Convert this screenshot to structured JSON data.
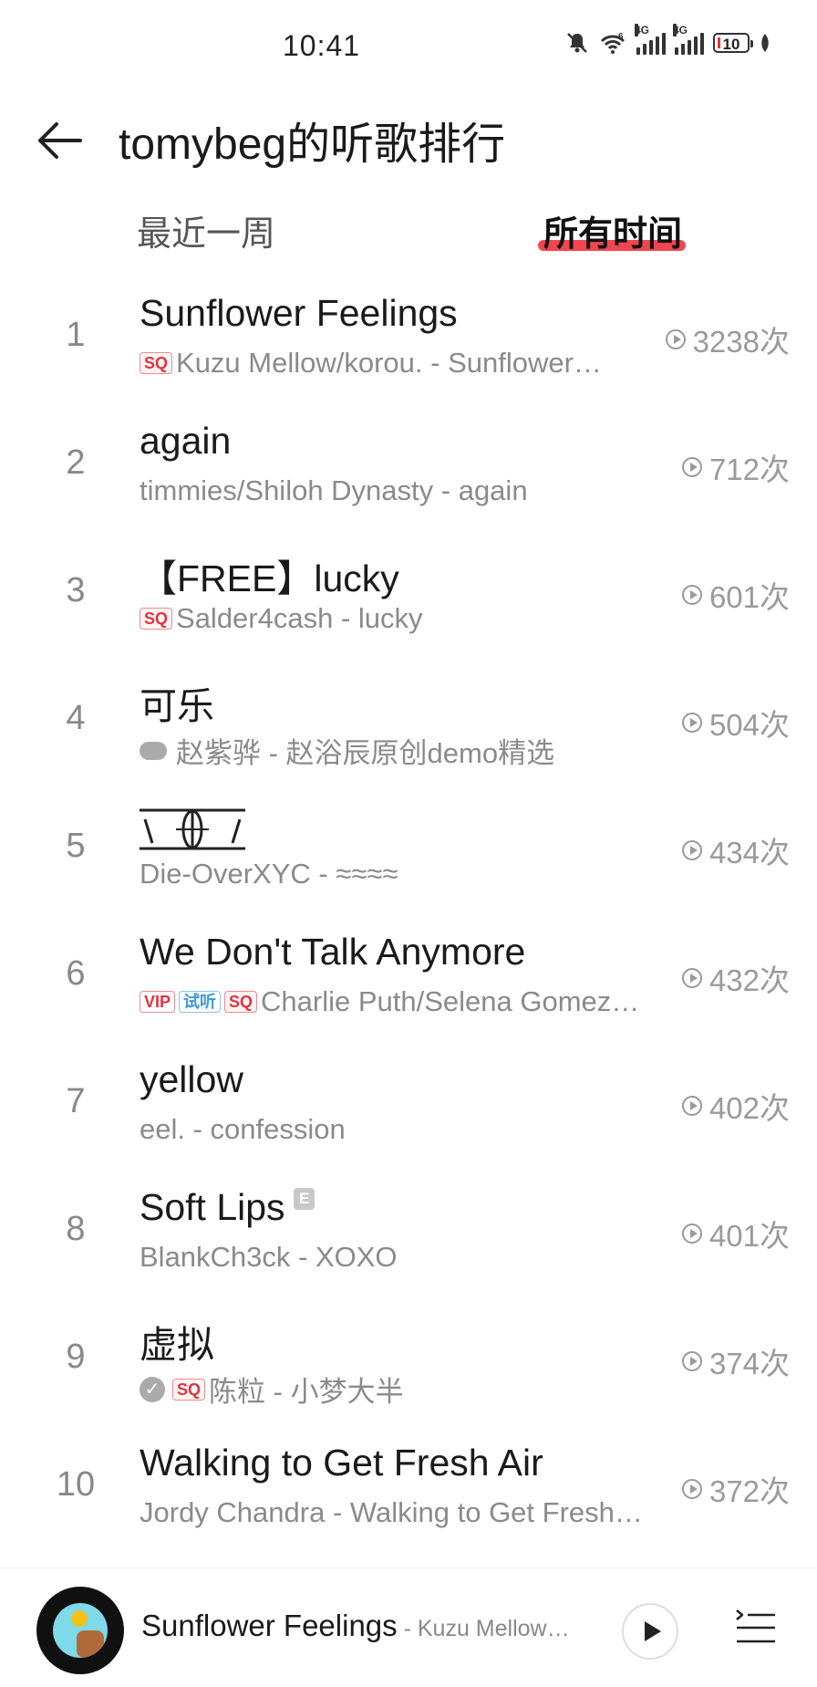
{
  "status": {
    "time": "10:41",
    "battery": "10",
    "net1": "4G",
    "net2": "4G",
    "wifi_label": "6"
  },
  "header": {
    "title": "tomybeg的听歌排行"
  },
  "tabs": [
    {
      "label": "最近一周"
    },
    {
      "label": "所有时间"
    }
  ],
  "list": [
    {
      "rank": "1",
      "title": "Sunflower Feelings",
      "subtitle": "Kuzu Mellow/korou. - Sunflower…",
      "plays": "3238次",
      "badges": [
        "SQ"
      ]
    },
    {
      "rank": "2",
      "title": "again",
      "subtitle": "timmies/Shiloh Dynasty - again",
      "plays": "712次",
      "badges": []
    },
    {
      "rank": "3",
      "title": "【FREE】lucky",
      "subtitle": "Salder4cash - lucky",
      "plays": "601次",
      "badges": [
        "SQ"
      ]
    },
    {
      "rank": "4",
      "title": "可乐",
      "subtitle": "赵紫骅 - 赵浴辰原创demo精选",
      "plays": "504次",
      "badges": [
        "cloud"
      ]
    },
    {
      "rank": "5",
      "title": "\\ (|) /",
      "subtitle": "Die-OverXYC - ≈≈≈≈",
      "plays": "434次",
      "badges": []
    },
    {
      "rank": "6",
      "title": "We Don't Talk Anymore",
      "subtitle": "Charlie Puth/Selena Gomez…",
      "plays": "432次",
      "badges": [
        "VIP",
        "试听",
        "SQ"
      ]
    },
    {
      "rank": "7",
      "title": "yellow",
      "subtitle": "eel. - confession",
      "plays": "402次",
      "badges": []
    },
    {
      "rank": "8",
      "title": "Soft Lips",
      "subtitle": "BlankCh3ck - XOXO",
      "plays": "401次",
      "badges": [
        "E"
      ]
    },
    {
      "rank": "9",
      "title": "虚拟",
      "subtitle": "陈粒 - 小梦大半",
      "plays": "374次",
      "badges": [
        "check",
        "SQ"
      ]
    },
    {
      "rank": "10",
      "title": "Walking to Get Fresh Air",
      "subtitle": "Jordy Chandra - Walking to Get Fresh…",
      "plays": "372次",
      "badges": []
    }
  ],
  "player": {
    "title": "Sunflower Feelings",
    "artist": " - Kuzu Mellow…"
  },
  "icons": {
    "back": "arrow-left-icon",
    "play": "play-icon",
    "playlist": "playlist-icon"
  },
  "colors": {
    "accent": "#f0323f",
    "badge_sq": "#e0333d",
    "badge_try": "#3a9ad9"
  }
}
